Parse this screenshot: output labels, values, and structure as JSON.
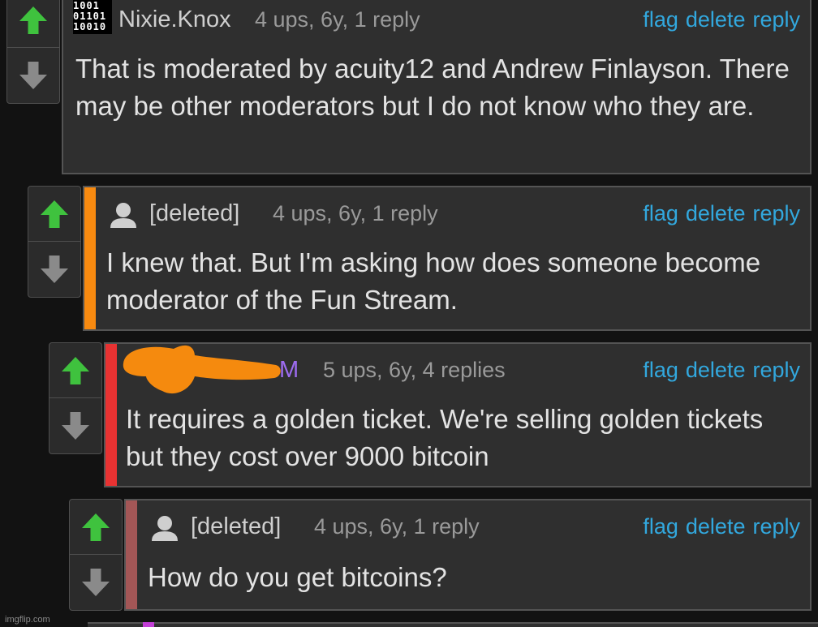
{
  "actions": {
    "flag": "flag",
    "delete": "delete",
    "reply": "reply"
  },
  "comments": [
    {
      "username": "Nixie.Knox",
      "meta": "4 ups, 6y, 1 reply",
      "avatar_icon": "binary-digits-avatar-icon",
      "avatar_text": [
        "1001",
        "01101",
        "10010"
      ],
      "text": "That is moderated by acuity12 and Andrew Finlayson. There may be other moderators but I do not know who they are."
    },
    {
      "username": "[deleted]",
      "meta": "4 ups, 6y, 1 reply",
      "avatar_icon": "default-user-avatar-icon",
      "depth_color": "#f88a10",
      "text": "I knew that. But I'm asking how does someone become moderator of the Fun Stream."
    },
    {
      "username": "M",
      "username_color": "#9d6cf0",
      "meta": "5 ups, 6y, 4 replies",
      "redaction_color": "#f58a0e",
      "depth_color": "#e83232",
      "text": "It requires a golden ticket. We're selling golden tickets but they cost over 9000 bitcoin"
    },
    {
      "username": "[deleted]",
      "meta": "4 ups, 6y, 1 reply",
      "avatar_icon": "default-user-avatar-icon",
      "depth_color": "#a35656",
      "text": "How do you get bitcoins?"
    }
  ],
  "colors": {
    "upvote": "#3fc23e",
    "downvote": "#8a8a8a",
    "link": "#32a8de"
  },
  "watermark": "imgflip.com"
}
